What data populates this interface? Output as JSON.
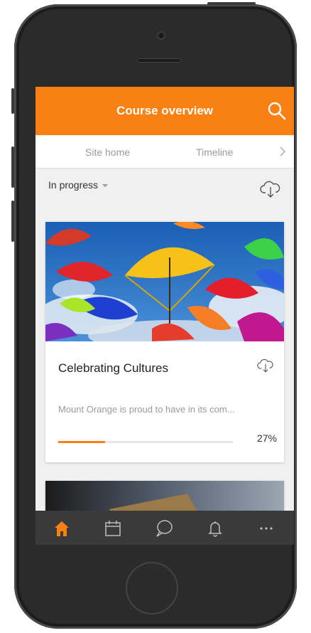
{
  "header": {
    "title": "Course overview",
    "search_icon": "search-icon"
  },
  "tabs": [
    {
      "label": "Site home"
    },
    {
      "label": "Timeline"
    }
  ],
  "filter": {
    "selected": "In progress"
  },
  "course": {
    "title": "Celebrating Cultures",
    "summary": "Mount Orange is proud to have in its com...",
    "progress_text": "27%",
    "progress_value": 27
  },
  "bottom_nav": [
    {
      "name": "home",
      "icon": "home-icon"
    },
    {
      "name": "calendar",
      "icon": "calendar-icon"
    },
    {
      "name": "messages",
      "icon": "chat-icon"
    },
    {
      "name": "notifications",
      "icon": "bell-icon"
    },
    {
      "name": "more",
      "icon": "more-icon"
    }
  ],
  "colors": {
    "accent": "#f98012",
    "tabbar": "#3a3a3a",
    "background": "#f0f0f0"
  }
}
